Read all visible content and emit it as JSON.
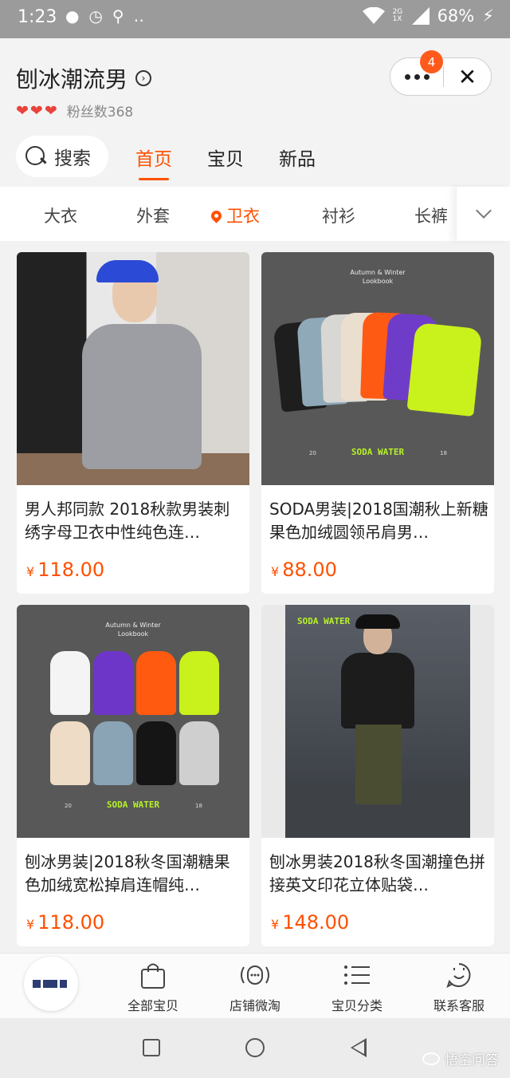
{
  "status_bar": {
    "time": "1:23",
    "battery": "68%",
    "signal_labels": "2G 1X"
  },
  "shop": {
    "name": "刨冰潮流男",
    "fans_label": "粉丝数368",
    "hearts": 3,
    "notification_count": "4"
  },
  "search": {
    "label": "搜索"
  },
  "tabs": [
    {
      "label": "首页",
      "active": true
    },
    {
      "label": "宝贝",
      "active": false
    },
    {
      "label": "新品",
      "active": false
    }
  ],
  "categories": [
    {
      "label": "大衣",
      "active": false
    },
    {
      "label": "外套",
      "active": false
    },
    {
      "label": "卫衣",
      "active": true
    },
    {
      "label": "衬衫",
      "active": false
    },
    {
      "label": "长裤",
      "active": false
    }
  ],
  "products": [
    {
      "title": "男人邦同款 2018秋款男装刺绣字母卫衣中性纯色连…",
      "currency": "¥",
      "price": "118.00"
    },
    {
      "title": "SODA男装|2018国潮秋上新糖果色加绒圆领吊肩男…",
      "currency": "¥",
      "price": "88.00",
      "image_text": {
        "lookbook": "Autumn & Winter\nLookbook",
        "brand": "SODA WATER",
        "left_num": "20",
        "right_num": "18"
      }
    },
    {
      "title": "刨冰男装|2018秋冬国潮糖果色加绒宽松掉肩连帽纯…",
      "currency": "¥",
      "price": "118.00",
      "image_text": {
        "lookbook": "Autumn & Winter\nLookbook",
        "brand": "SODA WATER",
        "left_num": "20",
        "right_num": "18"
      }
    },
    {
      "title": "刨冰男装2018秋冬国潮撞色拼接英文印花立体贴袋…",
      "currency": "¥",
      "price": "148.00",
      "image_text": {
        "brand": "SODA WATER"
      }
    }
  ],
  "tab_bar": [
    {
      "label": "全部宝贝",
      "icon": "bag-icon"
    },
    {
      "label": "店铺微淘",
      "icon": "broadcast-icon"
    },
    {
      "label": "宝贝分类",
      "icon": "list-icon"
    },
    {
      "label": "联系客服",
      "icon": "chat-icon"
    }
  ],
  "watermark": "悟空问答",
  "colors": {
    "accent": "#ff5000",
    "heart": "#e8443c",
    "badge": "#ff5a1c",
    "status_bar": "#9b9b9b"
  }
}
